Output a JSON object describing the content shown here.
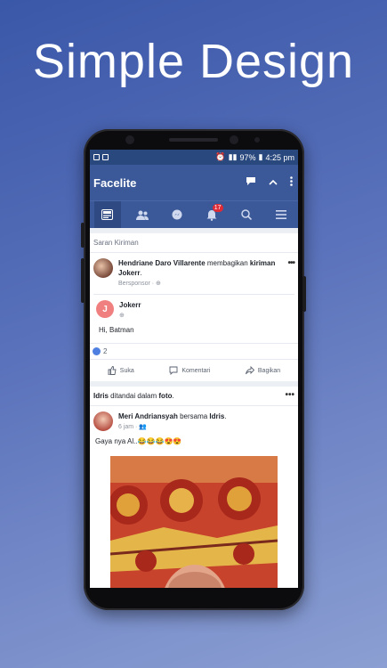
{
  "headline": "Simple Design",
  "status": {
    "left_icons": [
      "notification-icon",
      "notification-icon"
    ],
    "battery": "97%",
    "time": "4:25 pm"
  },
  "app": {
    "title": "Facelite",
    "tabs": [
      {
        "name": "news-feed",
        "icon": "news-feed-icon"
      },
      {
        "name": "friends",
        "icon": "friends-icon"
      },
      {
        "name": "messenger",
        "icon": "messenger-icon"
      },
      {
        "name": "notifications",
        "icon": "bell-icon",
        "badge": "17"
      },
      {
        "name": "search",
        "icon": "search-icon"
      },
      {
        "name": "menu",
        "icon": "menu-icon"
      }
    ]
  },
  "post1": {
    "header": "Saran Kiriman",
    "author": "Hendriane Daro Villarente",
    "action": " membagikan ",
    "target": "kiriman Jokerr",
    "meta": "Bersponsor · ",
    "shared": {
      "avatar_letter": "J",
      "author": "Jokerr",
      "text": "Hi, Batman"
    },
    "reactions_count": "2",
    "like_label": "Suka",
    "comment_label": "Komentari",
    "share_label": "Bagikan"
  },
  "post2": {
    "header_name": "Idris",
    "header_action": " ditandai dalam ",
    "header_target": "foto",
    "author": "Meri Andriansyah",
    "with": " bersama ",
    "tagged": "Idris",
    "meta": "6 jam · ",
    "text": "Gaya nya Al..😂😂😂😍😍"
  },
  "colors": {
    "brand": "#3b5998",
    "statusbar": "#29487d",
    "badge": "#e02a35"
  }
}
